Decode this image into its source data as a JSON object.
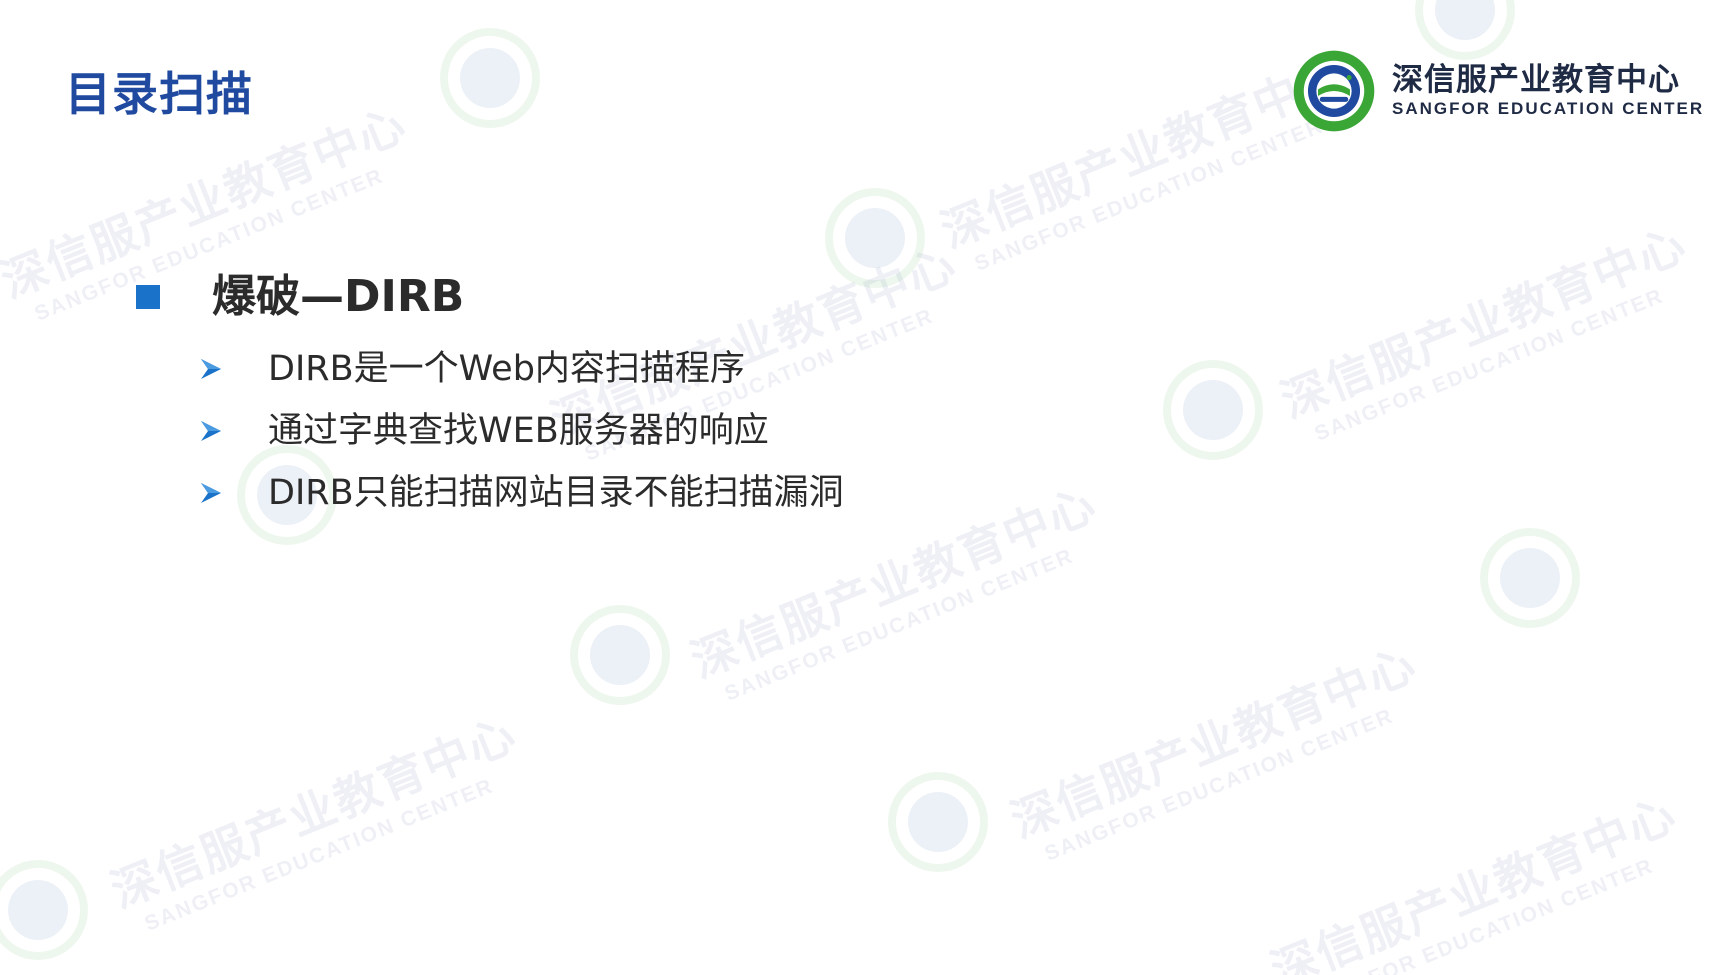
{
  "title": "目录扫描",
  "brand": {
    "name_cn": "深信服产业教育中心",
    "name_en": "SANGFOR EDUCATION CENTER"
  },
  "watermark": {
    "text_cn": "深信服产业教育中心",
    "text_en": "SANGFOR EDUCATION CENTER"
  },
  "section": {
    "heading": "爆破—DIRB",
    "items": [
      {
        "text": "DIRB是一个Web内容扫描程序"
      },
      {
        "text": "通过字典查找WEB服务器的响应"
      },
      {
        "text": "DIRB只能扫描网站目录不能扫描漏洞"
      }
    ]
  },
  "colors": {
    "title": "#1f4aa0",
    "bullet_square": "#1a73c8",
    "arrow": "#1a73c8",
    "brand_green": "#3aa635",
    "brand_blue": "#1f4aa0",
    "text": "#2b2b2b"
  },
  "icons": {
    "section_bullet": "square-bullet-icon",
    "item_bullet": "arrow-right-icon",
    "brand": "sangfor-emblem-icon"
  }
}
